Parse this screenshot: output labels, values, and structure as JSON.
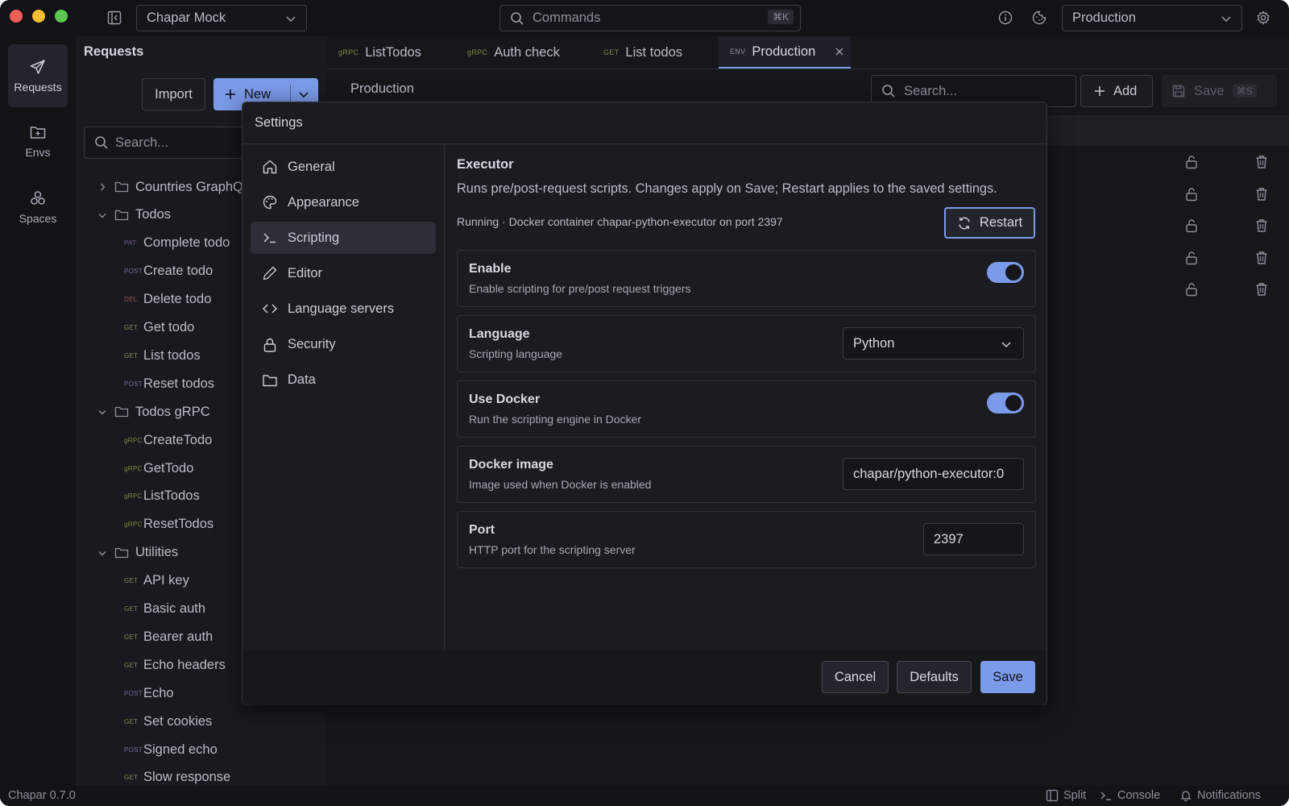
{
  "app": {
    "workspace": "Chapar Mock",
    "version": "Chapar 0.7.0"
  },
  "colors": {
    "accent": "#7b9be8",
    "background": "#16171b"
  },
  "titlebar": {
    "commands_placeholder": "Commands",
    "commands_shortcut": "⌘K",
    "environment": "Production"
  },
  "sidebar": {
    "items": [
      {
        "label": "Requests",
        "icon": "send-icon"
      },
      {
        "label": "Envs",
        "icon": "env-folder-icon"
      },
      {
        "label": "Spaces",
        "icon": "spaces-icon"
      }
    ]
  },
  "requests": {
    "title": "Requests",
    "import_label": "Import",
    "new_label": "New",
    "search_placeholder": "Search...",
    "tree": [
      {
        "type": "folder",
        "label": "Countries GraphQL",
        "expanded": false
      },
      {
        "type": "folder",
        "label": "Todos",
        "expanded": true
      },
      {
        "type": "item",
        "method": "PAT",
        "label": "Complete todo"
      },
      {
        "type": "item",
        "method": "POST",
        "label": "Create todo"
      },
      {
        "type": "item",
        "method": "DEL",
        "label": "Delete todo"
      },
      {
        "type": "item",
        "method": "GET",
        "label": "Get todo"
      },
      {
        "type": "item",
        "method": "GET",
        "label": "List todos"
      },
      {
        "type": "item",
        "method": "POST",
        "label": "Reset todos"
      },
      {
        "type": "folder",
        "label": "Todos gRPC",
        "expanded": true
      },
      {
        "type": "item",
        "method": "gRPC",
        "label": "CreateTodo"
      },
      {
        "type": "item",
        "method": "gRPC",
        "label": "GetTodo"
      },
      {
        "type": "item",
        "method": "gRPC",
        "label": "ListTodos"
      },
      {
        "type": "item",
        "method": "gRPC",
        "label": "ResetTodos"
      },
      {
        "type": "folder",
        "label": "Utilities",
        "expanded": true
      },
      {
        "type": "item",
        "method": "GET",
        "label": "API key"
      },
      {
        "type": "item",
        "method": "GET",
        "label": "Basic auth"
      },
      {
        "type": "item",
        "method": "GET",
        "label": "Bearer auth"
      },
      {
        "type": "item",
        "method": "GET",
        "label": "Echo headers"
      },
      {
        "type": "item",
        "method": "POST",
        "label": "Echo"
      },
      {
        "type": "item",
        "method": "GET",
        "label": "Set cookies"
      },
      {
        "type": "item",
        "method": "POST",
        "label": "Signed echo"
      },
      {
        "type": "item",
        "method": "GET",
        "label": "Slow response"
      }
    ]
  },
  "tabs": [
    {
      "method": "gRPC",
      "label": "ListTodos"
    },
    {
      "method": "gRPC",
      "label": "Auth check"
    },
    {
      "method": "GET",
      "label": "List todos"
    },
    {
      "method": "ENV",
      "label": "Production",
      "active": true
    }
  ],
  "env_page": {
    "name": "Production",
    "search_placeholder": "Search...",
    "add_label": "Add",
    "save_label": "Save",
    "save_shortcut": "⌘S"
  },
  "settings": {
    "title": "Settings",
    "nav": [
      {
        "label": "General",
        "icon": "home-icon"
      },
      {
        "label": "Appearance",
        "icon": "palette-icon"
      },
      {
        "label": "Scripting",
        "icon": "terminal-icon",
        "active": true
      },
      {
        "label": "Editor",
        "icon": "pencil-icon"
      },
      {
        "label": "Language servers",
        "icon": "code-icon"
      },
      {
        "label": "Security",
        "icon": "lock-icon"
      },
      {
        "label": "Data",
        "icon": "folder-icon"
      }
    ],
    "section_title": "Executor",
    "section_desc": "Runs pre/post-request scripts. Changes apply on Save; Restart applies to the saved settings.",
    "status": "Running · Docker container chapar-python-executor on port 2397",
    "restart_label": "Restart",
    "enable": {
      "title": "Enable",
      "desc": "Enable scripting for pre/post request triggers",
      "on": true
    },
    "language": {
      "title": "Language",
      "desc": "Scripting language",
      "value": "Python"
    },
    "docker": {
      "title": "Use Docker",
      "desc": "Run the scripting engine in Docker",
      "on": true
    },
    "image": {
      "title": "Docker image",
      "desc": "Image used when Docker is enabled",
      "value": "chapar/python-executor:0"
    },
    "port": {
      "title": "Port",
      "desc": "HTTP port for the scripting server",
      "value": "2397"
    },
    "cancel_label": "Cancel",
    "defaults_label": "Defaults",
    "save_label": "Save"
  },
  "statusbar": {
    "split_label": "Split",
    "console_label": "Console",
    "notifications_label": "Notifications"
  }
}
